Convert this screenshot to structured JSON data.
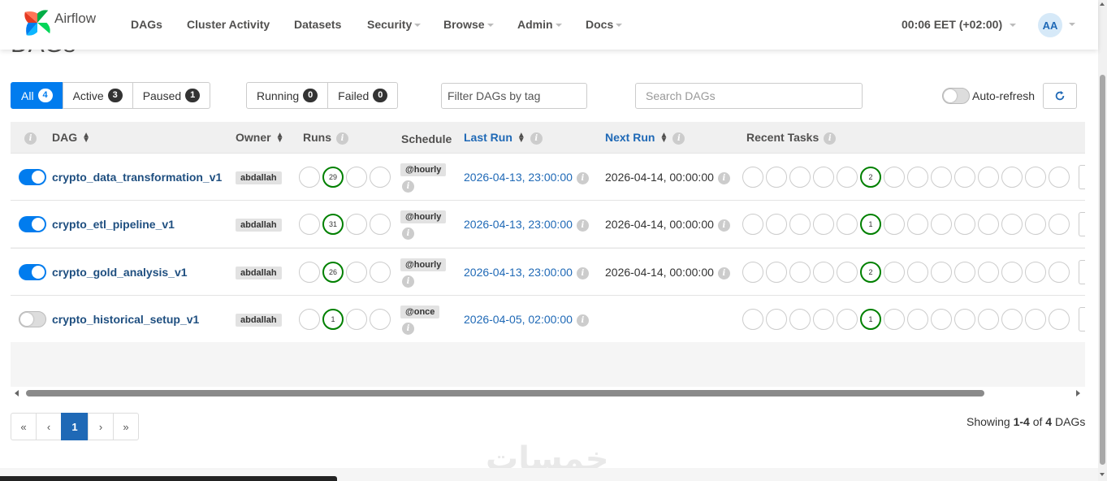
{
  "brand": {
    "name": "Airflow"
  },
  "nav": {
    "items": [
      "DAGs",
      "Cluster Activity",
      "Datasets",
      "Security",
      "Browse",
      "Admin",
      "Docs"
    ],
    "clock": "00:06 EET (+02:00)",
    "avatar": "AA"
  },
  "page": {
    "title": "DAGs"
  },
  "filters": {
    "status": [
      {
        "label": "All",
        "count": "4"
      },
      {
        "label": "Active",
        "count": "3"
      },
      {
        "label": "Paused",
        "count": "1"
      }
    ],
    "state": [
      {
        "label": "Running",
        "count": "0"
      },
      {
        "label": "Failed",
        "count": "0"
      }
    ],
    "tag_placeholder": "Filter DAGs by tag",
    "search_placeholder": "Search DAGs",
    "autorefresh_label": "Auto-refresh"
  },
  "table": {
    "headers": {
      "dag": "DAG",
      "owner": "Owner",
      "runs": "Runs",
      "schedule": "Schedule",
      "last_run": "Last Run",
      "next_run": "Next Run",
      "recent_tasks": "Recent Tasks"
    },
    "rows": [
      {
        "dag_id": "crypto_data_transformation_v1",
        "active": true,
        "owner": "abdallah",
        "runs_success": "29",
        "schedule": "@hourly",
        "last_run": "2026-04-13, 23:00:00",
        "next_run": "2026-04-14, 00:00:00",
        "tasks_success": "2"
      },
      {
        "dag_id": "crypto_etl_pipeline_v1",
        "active": true,
        "owner": "abdallah",
        "runs_success": "31",
        "schedule": "@hourly",
        "last_run": "2026-04-13, 23:00:00",
        "next_run": "2026-04-14, 00:00:00",
        "tasks_success": "1"
      },
      {
        "dag_id": "crypto_gold_analysis_v1",
        "active": true,
        "owner": "abdallah",
        "runs_success": "26",
        "schedule": "@hourly",
        "last_run": "2026-04-13, 23:00:00",
        "next_run": "2026-04-14, 00:00:00",
        "tasks_success": "2"
      },
      {
        "dag_id": "crypto_historical_setup_v1",
        "active": false,
        "owner": "abdallah",
        "runs_success": "1",
        "schedule": "@once",
        "last_run": "2026-04-05, 02:00:00",
        "next_run": "",
        "tasks_success": "1"
      }
    ]
  },
  "pagination": {
    "first": "«",
    "prev": "‹",
    "current": "1",
    "next": "›",
    "last": "»",
    "showing_prefix": "Showing ",
    "range": "1-4",
    "of": " of ",
    "total": "4",
    "suffix": " DAGs"
  },
  "watermark": "خمسات",
  "colors": {
    "primary": "#017cee",
    "success": "#008000",
    "link": "#1f69b6"
  }
}
